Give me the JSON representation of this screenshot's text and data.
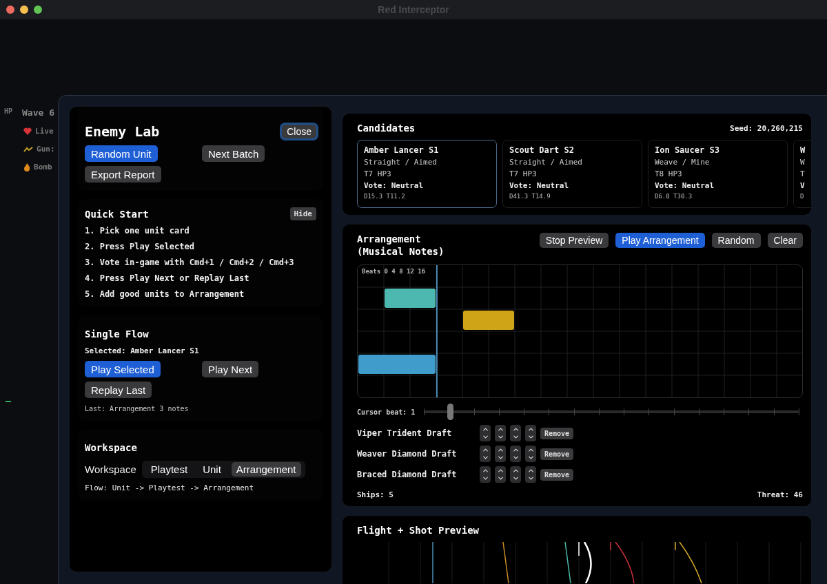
{
  "window": {
    "title": "Red Interceptor"
  },
  "hud": {
    "hp_label": "HP",
    "wave": "Wave 6",
    "stats": [
      {
        "kind": "heart",
        "label": "Live"
      },
      {
        "kind": "gun",
        "label": "Gun:"
      },
      {
        "kind": "bomb",
        "label": "Bomb"
      }
    ]
  },
  "lab": {
    "title": "Enemy Lab",
    "close": {
      "label": "Close",
      "focused": true
    },
    "actions": [
      {
        "label": "Random Unit",
        "kind": "primary"
      },
      {
        "label": "Next Batch",
        "kind": "secondary"
      },
      {
        "label": "Export Report",
        "kind": "secondary"
      }
    ],
    "quick_start": {
      "title": "Quick Start",
      "hide": "Hide",
      "steps": [
        "1. Pick one unit card",
        "2. Press Play Selected",
        "3. Vote in-game with Cmd+1 / Cmd+2 / Cmd+3",
        "4. Press Play Next or Replay Last",
        "5. Add good units to Arrangement"
      ]
    },
    "single_flow": {
      "title": "Single Flow",
      "selected": "Selected: Amber Lancer S1",
      "buttons": [
        {
          "label": "Play Selected",
          "kind": "primary"
        },
        {
          "label": "Play Next",
          "kind": "secondary"
        },
        {
          "label": "Replay Last",
          "kind": "secondary"
        }
      ],
      "last": "Last: Arrangement 3 notes"
    },
    "workspace": {
      "title": "Workspace",
      "label": "Workspace",
      "tabs": [
        {
          "label": "Playtest",
          "selected": false
        },
        {
          "label": "Unit",
          "selected": false
        },
        {
          "label": "Arrangement",
          "selected": true
        }
      ],
      "flow": "Flow: Unit -> Playtest -> Arrangement"
    }
  },
  "candidates": {
    "title": "Candidates",
    "seed": "Seed: 20,260,215",
    "cards": [
      {
        "name": "Amber Lancer S1",
        "pattern": "Straight / Aimed",
        "stats": "T7 HP3",
        "vote": "Vote: Neutral",
        "metrics": "D15.3 T11.2",
        "selected": true
      },
      {
        "name": "Scout Dart S2",
        "pattern": "Straight / Aimed",
        "stats": "T7 HP3",
        "vote": "Vote: Neutral",
        "metrics": "D41.3 T14.9",
        "selected": false
      },
      {
        "name": "Ion Saucer S3",
        "pattern": "Weave / Mine",
        "stats": "T8 HP3",
        "vote": "Vote: Neutral",
        "metrics": "D6.0 T30.3",
        "selected": false
      },
      {
        "name": "W",
        "pattern": "W",
        "stats": "T",
        "vote": "V",
        "metrics": "D",
        "selected": false
      }
    ]
  },
  "arrangement": {
    "title": "Arrangement\n(Musical Notes)",
    "buttons": [
      {
        "label": "Stop Preview",
        "kind": "secondary"
      },
      {
        "label": "Play Arrangement",
        "kind": "primary"
      },
      {
        "label": "Random",
        "kind": "secondary"
      },
      {
        "label": "Clear",
        "kind": "secondary"
      }
    ],
    "grid_header": "Beats 0 4 8 12 16",
    "cursor": {
      "label": "Cursor beat: 1",
      "level": 0.07
    },
    "units": [
      {
        "name": "Viper Trident Draft",
        "remove": "Remove"
      },
      {
        "name": "Weaver Diamond Draft",
        "remove": "Remove"
      },
      {
        "name": "Braced Diamond Draft",
        "remove": "Remove"
      }
    ],
    "ships": "Ships: 5",
    "threat": "Threat: 46"
  },
  "preview": {
    "title": "Flight + Shot Preview"
  }
}
